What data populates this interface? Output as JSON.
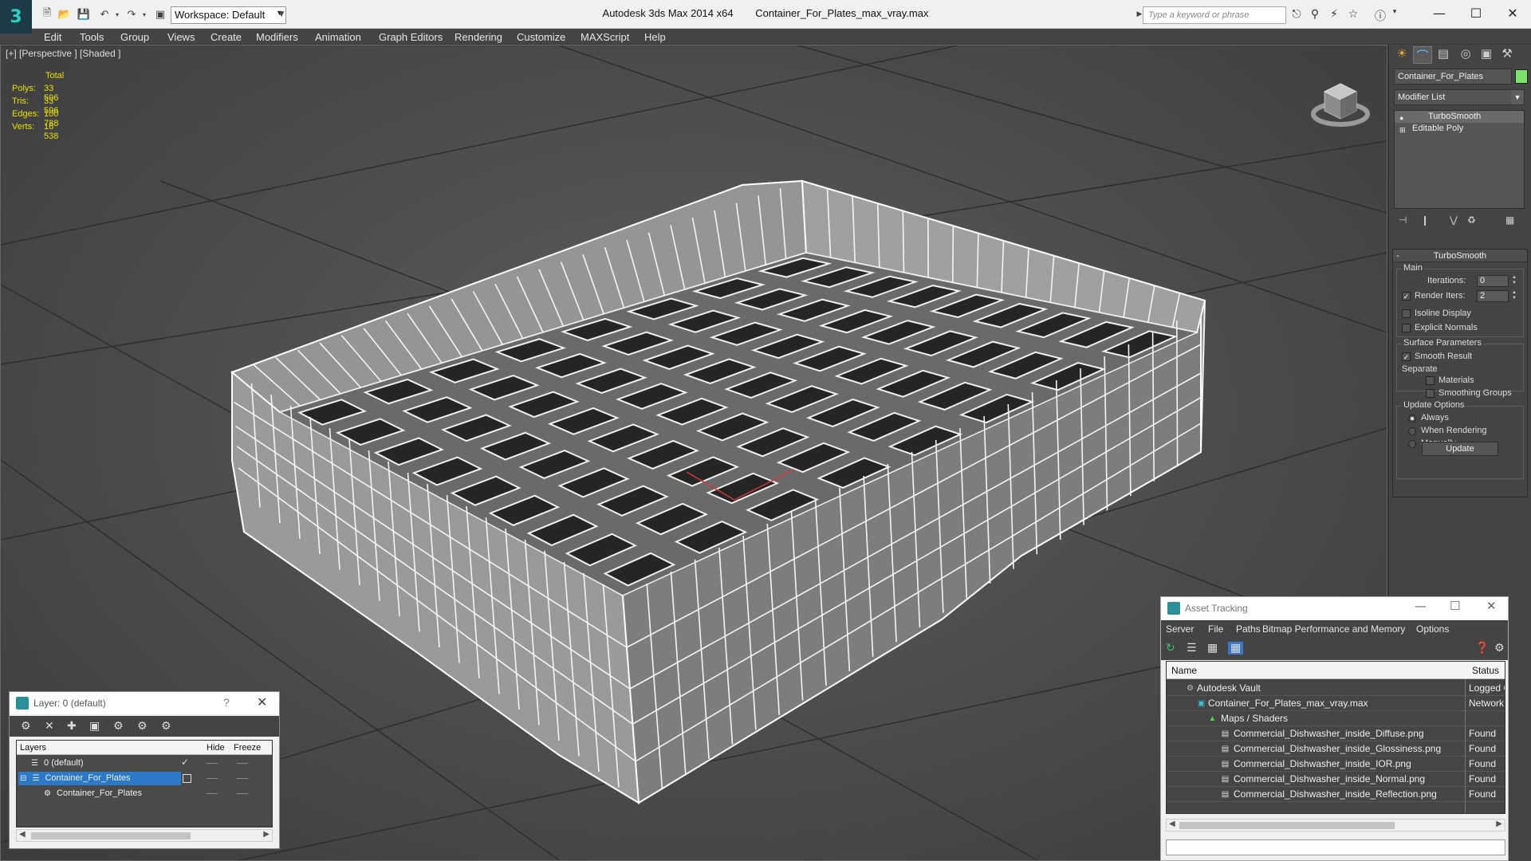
{
  "titlebar": {
    "workspace": "Workspace: Default",
    "app_title": "Autodesk 3ds Max  2014 x64",
    "file_title": "Container_For_Plates_max_vray.max",
    "search_placeholder": "Type a keyword or phrase"
  },
  "menu": [
    "Edit",
    "Tools",
    "Group",
    "Views",
    "Create",
    "Modifiers",
    "Animation",
    "Graph Editors",
    "Rendering",
    "Customize",
    "MAXScript",
    "Help"
  ],
  "viewport": {
    "label": "[+] [Perspective ] [Shaded ]",
    "stats": {
      "header": "Total",
      "polys_label": "Polys:",
      "polys": "33 596",
      "tris_label": "Tris:",
      "tris": "33 596",
      "edges_label": "Edges:",
      "edges": "100 788",
      "verts_label": "Verts:",
      "verts": "16 538"
    }
  },
  "command_panel": {
    "object_name": "Container_For_Plates",
    "object_color": "#7ce36a",
    "modifier_list": "Modifier List",
    "stack": [
      "TurboSmooth",
      "Editable Poly"
    ],
    "turbosmooth": {
      "title": "TurboSmooth",
      "main": "Main",
      "iterations_label": "Iterations:",
      "iterations": "0",
      "render_iters_label": "Render Iters:",
      "render_iters": "2",
      "isoline": "Isoline Display",
      "explicit_normals": "Explicit Normals",
      "surface_params": "Surface Parameters",
      "smooth_result": "Smooth Result",
      "separate": "Separate",
      "materials": "Materials",
      "smoothing_groups": "Smoothing Groups",
      "update_options": "Update Options",
      "always": "Always",
      "when_rendering": "When Rendering",
      "manually": "Manually",
      "update_button": "Update"
    }
  },
  "layer_dialog": {
    "title": "Layer: 0 (default)",
    "help": "?",
    "columns": {
      "layers": "Layers",
      "hide": "Hide",
      "freeze": "Freeze"
    },
    "rows": [
      "0 (default)",
      "Container_For_Plates",
      "Container_For_Plates"
    ]
  },
  "asset_dialog": {
    "title": "Asset Tracking",
    "menu": [
      "Server",
      "File",
      "Paths",
      "Bitmap Performance and Memory",
      "Options"
    ],
    "columns": {
      "name": "Name",
      "status": "Status"
    },
    "rows": [
      {
        "name": "Autodesk Vault",
        "status": "Logged O"
      },
      {
        "name": "Container_For_Plates_max_vray.max",
        "status": "Network P"
      },
      {
        "name": "Maps / Shaders",
        "status": ""
      },
      {
        "name": "Commercial_Dishwasher_inside_Diffuse.png",
        "status": "Found"
      },
      {
        "name": "Commercial_Dishwasher_inside_Glossiness.png",
        "status": "Found"
      },
      {
        "name": "Commercial_Dishwasher_inside_IOR.png",
        "status": "Found"
      },
      {
        "name": "Commercial_Dishwasher_inside_Normal.png",
        "status": "Found"
      },
      {
        "name": "Commercial_Dishwasher_inside_Reflection.png",
        "status": "Found"
      }
    ]
  }
}
